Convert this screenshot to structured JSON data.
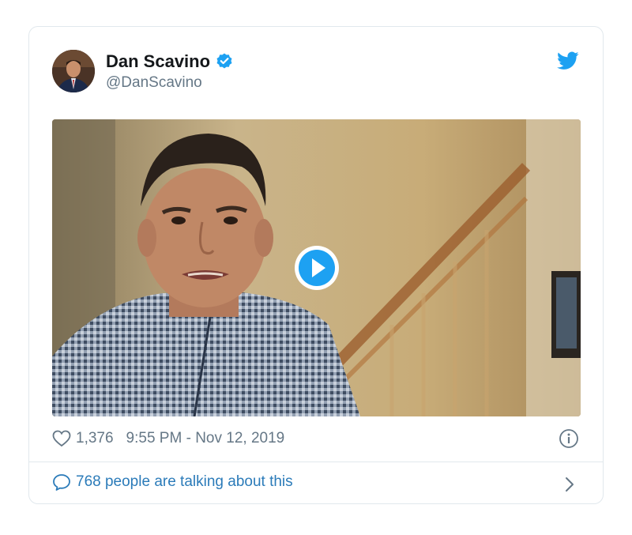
{
  "author": {
    "name": "Dan Scavino",
    "handle": "@DanScavino",
    "verified": true
  },
  "icons": {
    "brand": "twitter-bird-icon",
    "verified": "verified-badge-icon",
    "play": "play-icon",
    "like": "heart-icon",
    "info": "info-icon",
    "reply": "speech-bubble-icon",
    "more": "chevron-right-icon"
  },
  "media": {
    "type": "video",
    "description_visible": false
  },
  "meta": {
    "likes": "1,376",
    "timestamp": "9:55 PM - Nov 12, 2019"
  },
  "footer": {
    "talking_label": "768 people are talking about this"
  },
  "colors": {
    "brand_blue": "#1da1f2",
    "link_blue": "#2b7bb9",
    "secondary_text": "#657786",
    "border": "#e1e8ed"
  }
}
